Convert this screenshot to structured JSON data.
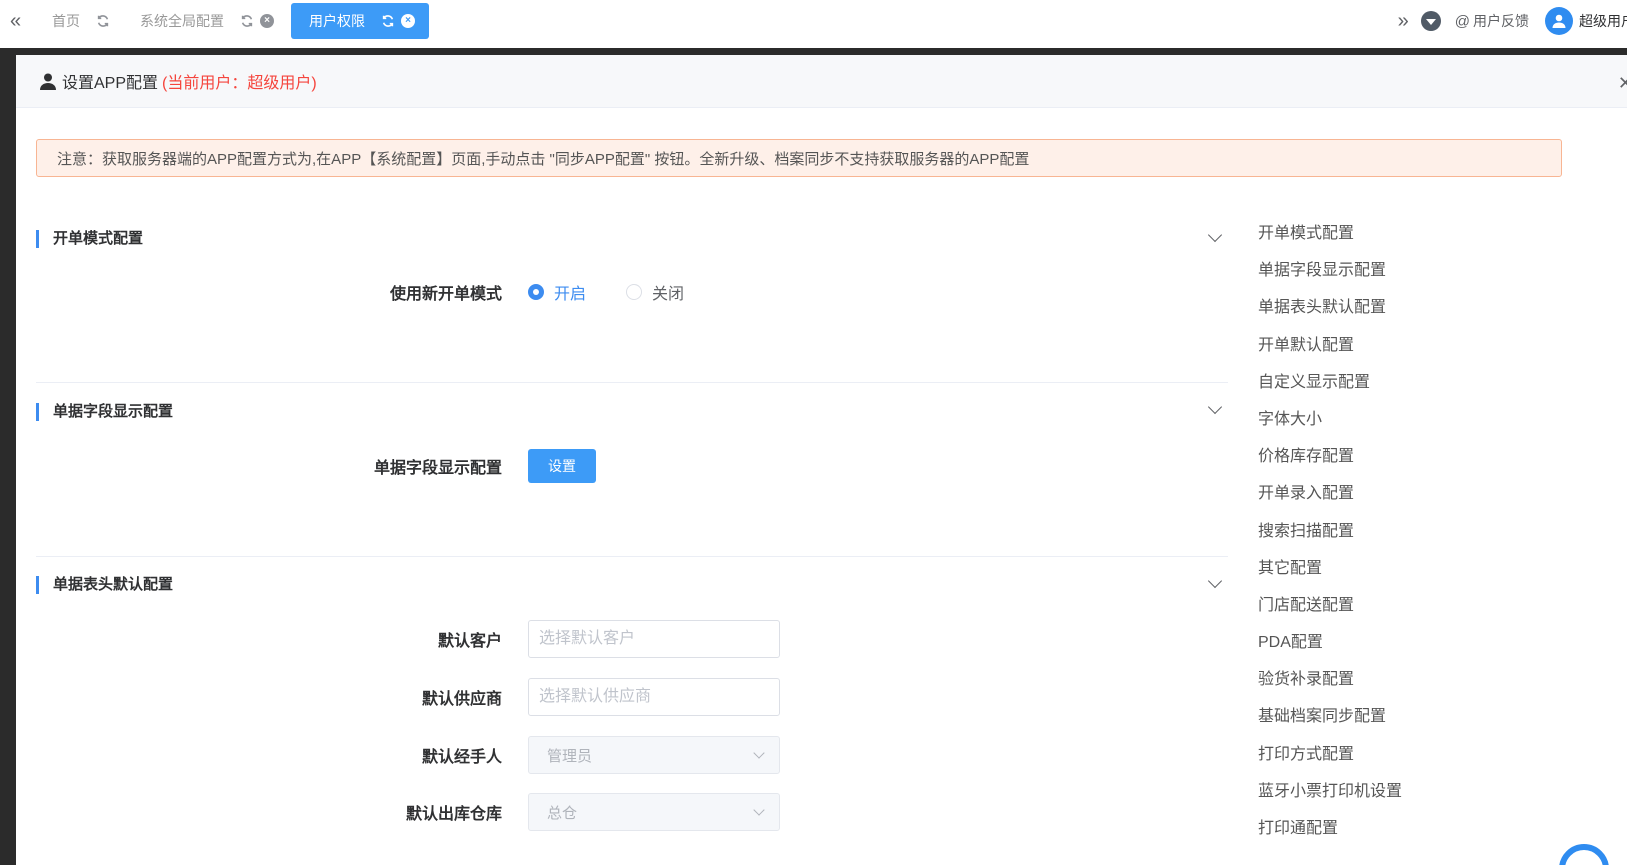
{
  "tabs": [
    {
      "label": "首页",
      "active": false,
      "closable": false
    },
    {
      "label": "系统全局配置",
      "active": false,
      "closable": true
    },
    {
      "label": "用户权限",
      "active": true,
      "closable": true
    }
  ],
  "header_right": {
    "feedback_label": "用户反馈",
    "user_name": "超级用户"
  },
  "dialog": {
    "title": "设置APP配置",
    "subtitle": "(当前用户：超级用户)",
    "notice": "注意：获取服务器端的APP配置方式为,在APP【系统配置】页面,手动点击 \"同步APP配置\" 按钮。全新升级、档案同步不支持获取服务器的APP配置"
  },
  "sections": {
    "open_mode": {
      "title": "开单模式配置",
      "field_label": "使用新开单模式",
      "options": [
        "开启",
        "关闭"
      ],
      "selected": "开启"
    },
    "field_display": {
      "title": "单据字段显示配置",
      "field_label": "单据字段显示配置",
      "button_label": "设置"
    },
    "header_default": {
      "title": "单据表头默认配置",
      "customer_label": "默认客户",
      "customer_placeholder": "选择默认客户",
      "supplier_label": "默认供应商",
      "supplier_placeholder": "选择默认供应商",
      "handler_label": "默认经手人",
      "handler_value": "管理员",
      "warehouse_label": "默认出库仓库",
      "warehouse_value": "总仓"
    }
  },
  "anchor_nav": [
    "开单模式配置",
    "单据字段显示配置",
    "单据表头默认配置",
    "开单默认配置",
    "自定义显示配置",
    "字体大小",
    "价格库存配置",
    "开单录入配置",
    "搜索扫描配置",
    "其它配置",
    "门店配送配置",
    "PDA配置",
    "验货补录配置",
    "基础档案同步配置",
    "打印方式配置",
    "蓝牙小票打印机设置",
    "打印通配置"
  ],
  "colors": {
    "primary": "#3d9bf7",
    "accent_red": "#f5453d",
    "notice_bg": "#fef0e9"
  }
}
